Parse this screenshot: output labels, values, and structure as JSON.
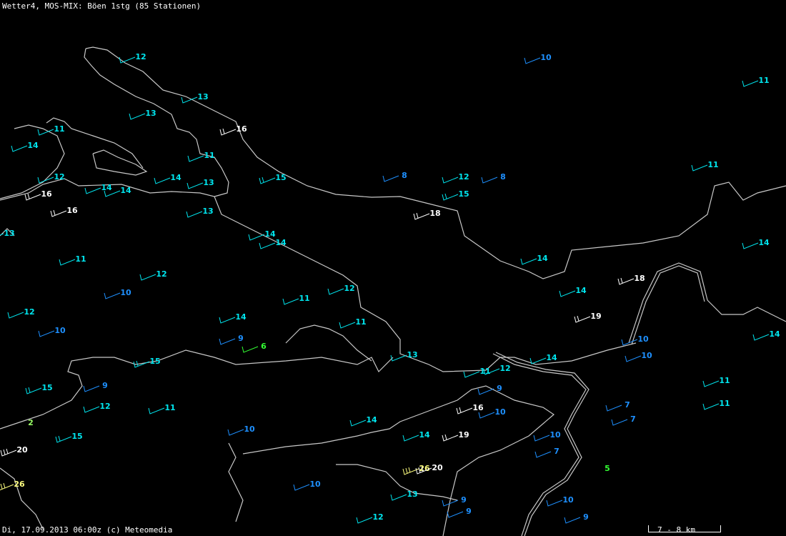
{
  "header": {
    "title": "Wetter4, MOS-MIX: Böen 1stg (85 Stationen)"
  },
  "footer": {
    "timestamp": "Di, 17.09.2013 06:00z (c) Meteomedia",
    "scale_label": "7 - 8 km"
  },
  "colors": {
    "cyan": "#00e5ee",
    "blue": "#1e90ff",
    "white": "#ffffff",
    "yellow": "#ffff80",
    "green": "#33ff33",
    "palegreen": "#99ff66",
    "coast": "#c8c8c8"
  },
  "stations": [
    {
      "v": "12",
      "c": "cyan"
    },
    {
      "v": "13",
      "c": "cyan"
    },
    {
      "v": "13",
      "c": "cyan"
    },
    {
      "v": "11",
      "c": "cyan"
    },
    {
      "v": "16",
      "c": "white"
    },
    {
      "v": "14",
      "c": "cyan"
    },
    {
      "v": "11",
      "c": "cyan"
    },
    {
      "v": "12",
      "c": "cyan"
    },
    {
      "v": "14",
      "c": "cyan"
    },
    {
      "v": "13",
      "c": "cyan"
    },
    {
      "v": "15",
      "c": "cyan"
    },
    {
      "v": "8",
      "c": "blue"
    },
    {
      "v": "12",
      "c": "cyan"
    },
    {
      "v": "8",
      "c": "blue"
    },
    {
      "v": "10",
      "c": "blue"
    },
    {
      "v": "11",
      "c": "cyan"
    },
    {
      "v": "11",
      "c": "cyan"
    },
    {
      "v": "16",
      "c": "white"
    },
    {
      "v": "14",
      "c": "cyan"
    },
    {
      "v": "14",
      "c": "cyan"
    },
    {
      "v": "16",
      "c": "white"
    },
    {
      "v": "13",
      "c": "cyan"
    },
    {
      "v": "15",
      "c": "cyan"
    },
    {
      "v": "18",
      "c": "white"
    },
    {
      "v": "13",
      "c": "cyan"
    },
    {
      "v": "14",
      "c": "cyan"
    },
    {
      "v": "14",
      "c": "cyan"
    },
    {
      "v": "14",
      "c": "cyan"
    },
    {
      "v": "11",
      "c": "cyan"
    },
    {
      "v": "14",
      "c": "cyan"
    },
    {
      "v": "12",
      "c": "cyan"
    },
    {
      "v": "18",
      "c": "white"
    },
    {
      "v": "10",
      "c": "blue"
    },
    {
      "v": "12",
      "c": "cyan"
    },
    {
      "v": "11",
      "c": "cyan"
    },
    {
      "v": "14",
      "c": "cyan"
    },
    {
      "v": "12",
      "c": "cyan"
    },
    {
      "v": "19",
      "c": "white"
    },
    {
      "v": "14",
      "c": "cyan"
    },
    {
      "v": "11",
      "c": "cyan"
    },
    {
      "v": "10",
      "c": "blue"
    },
    {
      "v": "9",
      "c": "blue"
    },
    {
      "v": "6",
      "c": "green"
    },
    {
      "v": "10",
      "c": "blue"
    },
    {
      "v": "10",
      "c": "blue"
    },
    {
      "v": "14",
      "c": "cyan"
    },
    {
      "v": "13",
      "c": "cyan"
    },
    {
      "v": "15",
      "c": "cyan"
    },
    {
      "v": "14",
      "c": "cyan"
    },
    {
      "v": "11",
      "c": "cyan"
    },
    {
      "v": "12",
      "c": "cyan"
    },
    {
      "v": "11",
      "c": "cyan"
    },
    {
      "v": "15",
      "c": "cyan"
    },
    {
      "v": "9",
      "c": "blue"
    },
    {
      "v": "9",
      "c": "blue"
    },
    {
      "v": "16",
      "c": "white"
    },
    {
      "v": "11",
      "c": "cyan"
    },
    {
      "v": "12",
      "c": "cyan"
    },
    {
      "v": "11",
      "c": "cyan"
    },
    {
      "v": "7",
      "c": "blue"
    },
    {
      "v": "10",
      "c": "blue"
    },
    {
      "v": "7",
      "c": "blue"
    },
    {
      "v": "2",
      "c": "palegreen"
    },
    {
      "v": "14",
      "c": "cyan"
    },
    {
      "v": "15",
      "c": "cyan"
    },
    {
      "v": "10",
      "c": "blue"
    },
    {
      "v": "14",
      "c": "cyan"
    },
    {
      "v": "19",
      "c": "white"
    },
    {
      "v": "10",
      "c": "blue"
    },
    {
      "v": "7",
      "c": "blue"
    },
    {
      "v": "20",
      "c": "white"
    },
    {
      "v": "26",
      "c": "yellow"
    },
    {
      "v": "20",
      "c": "white"
    },
    {
      "v": "5",
      "c": "green"
    },
    {
      "v": "26",
      "c": "yellow"
    },
    {
      "v": "10",
      "c": "blue"
    },
    {
      "v": "13",
      "c": "cyan"
    },
    {
      "v": "9",
      "c": "blue"
    },
    {
      "v": "9",
      "c": "blue"
    },
    {
      "v": "10",
      "c": "blue"
    },
    {
      "v": "12",
      "c": "cyan"
    },
    {
      "v": "9",
      "c": "blue"
    }
  ]
}
